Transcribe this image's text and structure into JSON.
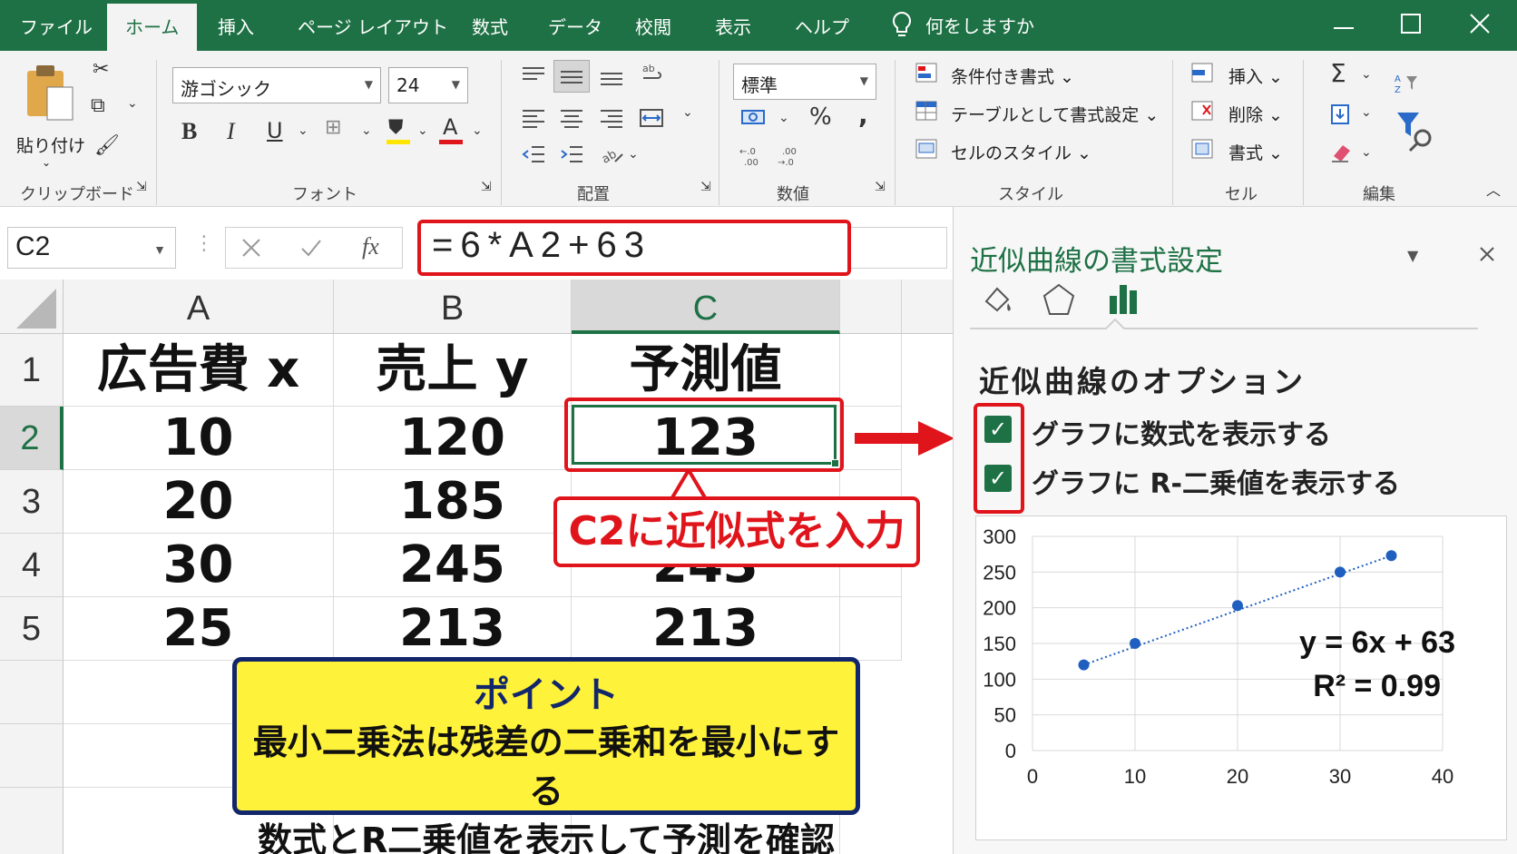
{
  "tabs": [
    "ファイル",
    "ホーム",
    "挿入",
    "ページ レイアウト",
    "数式",
    "データ",
    "校閲",
    "表示",
    "ヘルプ"
  ],
  "active_tab": "ホーム",
  "tell_me": "何をしますか",
  "window_controls": [
    "minimize",
    "maximize",
    "close"
  ],
  "ribbon": {
    "clipboard": {
      "paste_label": "貼り付け",
      "group_label": "クリップボード"
    },
    "font": {
      "font_name": "游ゴシック",
      "font_size": "24",
      "bold": "B",
      "italic": "I",
      "underline": "U",
      "font_color_glyph": "A",
      "group_label": "フォント"
    },
    "alignment": {
      "group_label": "配置"
    },
    "number": {
      "format": "標準",
      "percent": "%",
      "comma": ",",
      "group_label": "数値"
    },
    "styles": {
      "conditional": "条件付き書式 ⌄",
      "as_table": "テーブルとして書式設定 ⌄",
      "cell_styles": "セルのスタイル ⌄",
      "group_label": "スタイル"
    },
    "cells": {
      "insert": "挿入 ⌄",
      "delete": "削除 ⌄",
      "format": "書式 ⌄",
      "group_label": "セル"
    },
    "editing": {
      "group_label": "編集"
    }
  },
  "formula_bar": {
    "name_box": "C2",
    "fx": "fx",
    "formula": "=6*A2+63"
  },
  "sheet": {
    "columns": [
      "A",
      "B",
      "C"
    ],
    "rows": [
      "1",
      "2",
      "3",
      "4",
      "5"
    ],
    "headers": [
      "広告費 x",
      "売上 y",
      "予測値"
    ],
    "data": [
      [
        "10",
        "120",
        "123"
      ],
      [
        "20",
        "185",
        ""
      ],
      [
        "30",
        "245",
        "243"
      ],
      [
        "25",
        "213",
        "213"
      ]
    ],
    "selected_cell": "C2"
  },
  "annotations": {
    "callout": "C2に近似式を入力",
    "point_title": "ポイント",
    "point_line1": "最小二乗法は残差の二乗和を最小にする",
    "point_line2": "数式とR二乗値を表示して予測を確認"
  },
  "pane": {
    "title": "近似曲線の書式設定",
    "section": "近似曲線のオプション",
    "options": [
      {
        "label": "グラフに数式を表示する",
        "checked": true
      },
      {
        "label": "グラフに R-二乗値を表示する",
        "checked": true
      }
    ]
  },
  "chart_data": {
    "type": "scatter",
    "x": [
      5,
      10,
      20,
      30,
      35
    ],
    "y": [
      120,
      150,
      203,
      250,
      273
    ],
    "xlim": [
      0,
      40
    ],
    "ylim": [
      0,
      300
    ],
    "xticks": [
      0,
      10,
      20,
      30,
      40
    ],
    "yticks": [
      0,
      50,
      100,
      150,
      200,
      250,
      300
    ],
    "trendline": {
      "type": "linear",
      "style": "dotted",
      "equation": "y = 6x + 63",
      "r2_text": "R² = 0.99"
    },
    "grid": true,
    "marker_color": "#1f5fbf"
  },
  "colors": {
    "accent": "#1e7145",
    "highlight_red": "#e0141b",
    "note_yellow": "#fff23a",
    "note_border": "#12266b"
  }
}
